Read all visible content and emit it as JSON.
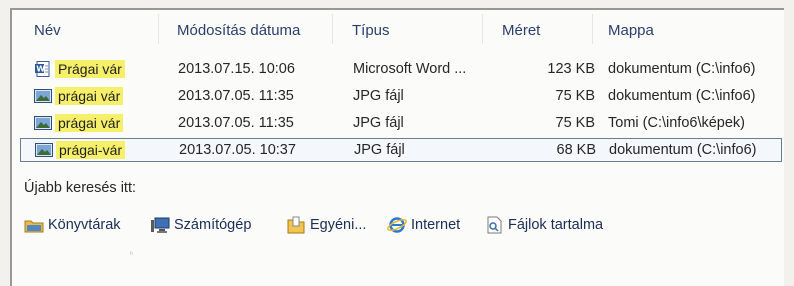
{
  "columns": {
    "name": "Név",
    "modified": "Módosítás dátuma",
    "type": "Típus",
    "size": "Méret",
    "folder": "Mappa"
  },
  "rows": [
    {
      "icon": "word-document-icon",
      "name": "Prágai vár",
      "modified": "2013.07.15. 10:06",
      "type": "Microsoft Word ...",
      "size": "123 KB",
      "folder": "dokumentum (C:\\info6)"
    },
    {
      "icon": "jpg-image-icon",
      "name": "prágai vár",
      "modified": "2013.07.05. 11:35",
      "type": "JPG fájl",
      "size": "75 KB",
      "folder": "dokumentum (C:\\info6)"
    },
    {
      "icon": "jpg-image-icon",
      "name": "prágai vár",
      "modified": "2013.07.05. 11:35",
      "type": "JPG fájl",
      "size": "75 KB",
      "folder": "Tomi (C:\\info6\\képek)"
    },
    {
      "icon": "jpg-image-icon",
      "name": "prágai-vár",
      "modified": "2013.07.05. 10:37",
      "type": "JPG fájl",
      "size": "68 KB",
      "folder": "dokumentum (C:\\info6)",
      "selected": true
    }
  ],
  "search_again": {
    "label": "Újabb keresés itt:",
    "options": [
      {
        "icon": "libraries-icon",
        "label": "Könyvtárak"
      },
      {
        "icon": "computer-icon",
        "label": "Számítógép"
      },
      {
        "icon": "custom-folder-icon",
        "label": "Egyéni..."
      },
      {
        "icon": "internet-explorer-icon",
        "label": "Internet"
      },
      {
        "icon": "file-contents-icon",
        "label": "Fájlok tartalma"
      }
    ]
  },
  "colors": {
    "highlight": "#f5ef6a",
    "header_text": "#2b3f6b",
    "link_text": "#1b2e55"
  }
}
